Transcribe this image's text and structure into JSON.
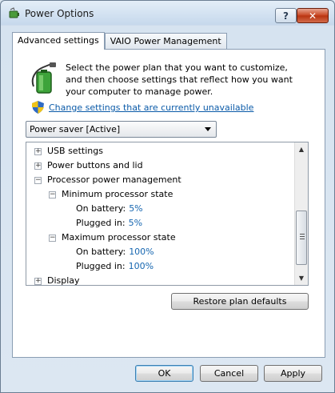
{
  "window": {
    "title": "Power Options",
    "help_label": "?",
    "close_label": "✕"
  },
  "tabs": [
    {
      "label": "Advanced settings",
      "active": true
    },
    {
      "label": "VAIO Power Management",
      "active": false
    }
  ],
  "intro_text": "Select the power plan that you want to customize, and then choose settings that reflect how you want your computer to manage power.",
  "change_link": "Change settings that are currently unavailable",
  "plan_select": {
    "value": "Power saver [Active]"
  },
  "tree": {
    "usb": {
      "expander": "+",
      "label": "USB settings"
    },
    "power_buttons": {
      "expander": "+",
      "label": "Power buttons and lid"
    },
    "processor": {
      "expander": "−",
      "label": "Processor power management"
    },
    "min_state": {
      "expander": "−",
      "label": "Minimum processor state"
    },
    "min_battery": {
      "label": "On battery:",
      "value": "5%"
    },
    "min_plugged": {
      "label": "Plugged in:",
      "value": "5%"
    },
    "max_state": {
      "expander": "−",
      "label": "Maximum processor state"
    },
    "max_battery": {
      "label": "On battery:",
      "value": "100%"
    },
    "max_plugged": {
      "label": "Plugged in:",
      "value": "100%"
    },
    "display": {
      "expander": "+",
      "label": "Display"
    }
  },
  "buttons": {
    "restore": "Restore plan defaults",
    "ok": "OK",
    "cancel": "Cancel",
    "apply": "Apply"
  },
  "colors": {
    "link": "#0a5aa8",
    "value": "#1666b0",
    "close_button": "#c7431f"
  },
  "icons": {
    "app": "power-options-icon",
    "battery": "battery-plug-icon",
    "shield": "uac-shield-icon"
  }
}
